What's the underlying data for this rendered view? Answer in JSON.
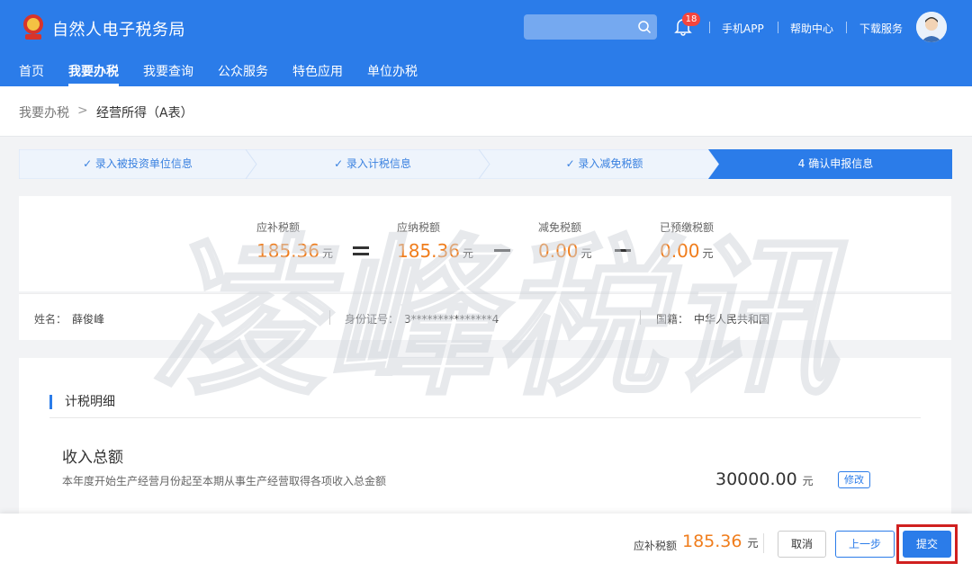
{
  "header": {
    "site_title": "自然人电子税务局",
    "search": {
      "value": "",
      "placeholder": ""
    },
    "notification_count": "18",
    "links": [
      "手机APP",
      "帮助中心",
      "下载服务"
    ]
  },
  "nav": {
    "items": [
      "首页",
      "我要办税",
      "我要查询",
      "公众服务",
      "特色应用",
      "单位办税"
    ],
    "active": "我要办税"
  },
  "breadcrumb": {
    "root": "我要办税",
    "separator": ">",
    "current": "经营所得（A表）"
  },
  "steps": [
    {
      "label": "✓ 录入被投资单位信息",
      "state": "done"
    },
    {
      "label": "✓ 录入计税信息",
      "state": "done"
    },
    {
      "label": "✓ 录入减免税额",
      "state": "done"
    },
    {
      "label": "4 确认申报信息",
      "state": "active"
    }
  ],
  "summary": {
    "payable": {
      "label": "应补税额",
      "value": "185.36",
      "unit": "元"
    },
    "taxable": {
      "label": "应纳税额",
      "value": "185.36",
      "unit": "元"
    },
    "exempt": {
      "label": "减免税额",
      "value": "0.00",
      "unit": "元"
    },
    "prepaid": {
      "label": "已预缴税额",
      "value": "0.00",
      "unit": "元"
    },
    "operators": [
      "=",
      "−",
      "−"
    ]
  },
  "taxpayer": {
    "name_label": "姓名：",
    "name": "薛俊峰",
    "id_label": "身份证号：",
    "id": "3***************4",
    "nationality_label": "国籍：",
    "nationality": "中华人民共和国"
  },
  "detail": {
    "section_title": "计税明细",
    "item_title": "收入总额",
    "item_desc": "本年度开始生产经营月份起至本期从事生产经营取得各项收入总金额",
    "item_value": "30000.00",
    "item_unit": "元",
    "edit_label": "修改"
  },
  "footer": {
    "payable_label": "应补税额",
    "payable_value": "185.36",
    "payable_unit": "元",
    "cancel_label": "取消",
    "prev_label": "上一步",
    "submit_label": "提交"
  },
  "watermark_text": "凌峰税讯",
  "colors": {
    "primary": "#2b7ce9",
    "amount": "#f07d1c",
    "highlight": "#d0201f"
  }
}
